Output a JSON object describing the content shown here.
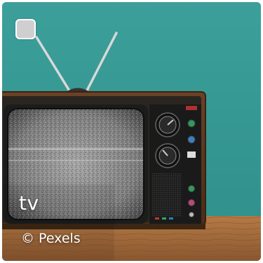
{
  "tile": {
    "label": "tv",
    "credit": "© Pexels"
  },
  "colors": {
    "wall": "#3b9e99",
    "floor": "#a06a3c",
    "cabinet": "#5a3720",
    "screen": "#8a8a8a",
    "panel": "#2a2a2a"
  }
}
